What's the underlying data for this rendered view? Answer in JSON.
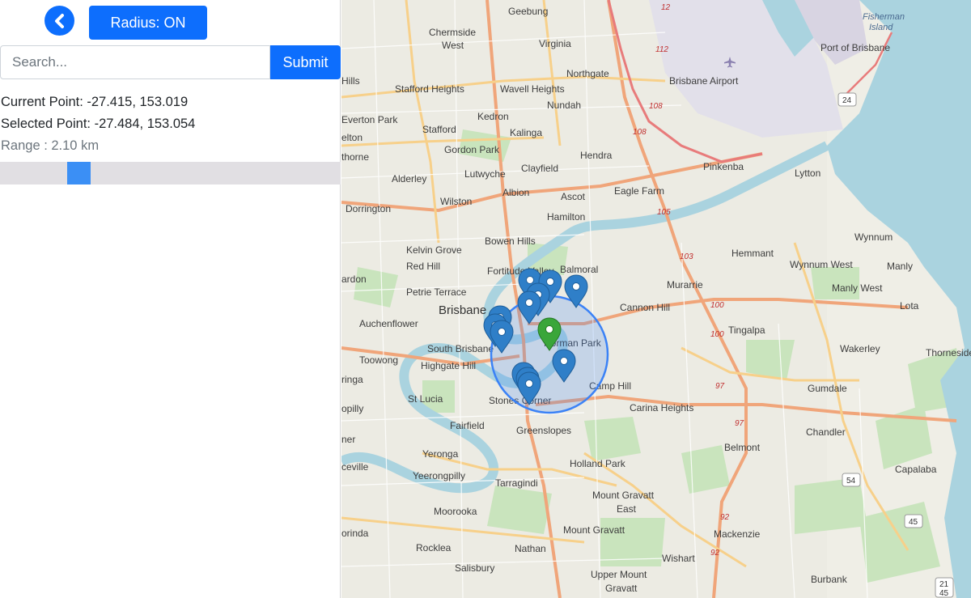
{
  "toolbar": {
    "back_icon": "chevron-left-icon",
    "radius_label": "Radius: ON"
  },
  "search": {
    "placeholder": "Search...",
    "value": "",
    "submit_label": "Submit"
  },
  "info": {
    "current_point": "Current Point: -27.415, 153.019",
    "selected_point": "Selected Point: -27.484, 153.054",
    "range": "Range : 2.10 km"
  },
  "range_slider": {
    "value_fraction": 0.23
  },
  "map": {
    "suburbs": [
      "Geebung",
      "Chermside",
      "West",
      "Virginia",
      "Northgate",
      "Stafford Heights",
      "Wavell Heights",
      "Nundah",
      "Brisbane Airport",
      "Port of Brisbane",
      "Fisherman",
      "Island",
      "Everton Park",
      "Kedron",
      "Stafford",
      "Kalinga",
      "Gordon Park",
      "Hendra",
      "Pinkenba",
      "Lytton",
      "Alderley",
      "Lutwyche",
      "Clayfield",
      "Ascot",
      "Eagle Farm",
      "Wilston",
      "Albion",
      "Hamilton",
      "Dorrington",
      "Bowen Hills",
      "Kelvin Grove",
      "Red Hill",
      "Fortitude Valley",
      "Balmoral",
      "Hemmant",
      "Wynnum",
      "Wynnum West",
      "Manly",
      "Petrie Terrace",
      "Brisbane",
      "Murarrie",
      "Cannon Hill",
      "Manly West",
      "Lota",
      "Auchenflower",
      "Norman Park",
      "Tingalpa",
      "South Brisbane",
      "Toowong",
      "Highgate Hill",
      "Wakerley",
      "Thorneside",
      "Camp Hill",
      "Gumdale",
      "St Lucia",
      "Stones Corner",
      "Carina Heights",
      "Fairfield",
      "Greenslopes",
      "Chandler",
      "Belmont",
      "Yeronga",
      "Holland Park",
      "Capalaba",
      "Yeerongpilly",
      "Tarragindi",
      "Moorooka",
      "Mount Gravatt",
      "East",
      "Mackenzie",
      "Rocklea",
      "Nathan",
      "Wishart",
      "Salisbury",
      "Upper Mount",
      "Gravatt",
      "Burbank",
      "Hills",
      "elton",
      "thorne",
      "ardon",
      "ringa",
      "opilly",
      "ner",
      "ceville",
      "orinda"
    ],
    "road_numbers": [
      "112",
      "12",
      "24",
      "108",
      "108",
      "105",
      "103",
      "100",
      "100",
      "97",
      "97",
      "92",
      "92"
    ],
    "shields": [
      "24",
      "54",
      "45",
      "21",
      "45"
    ],
    "marker_color": "#2f7fc8",
    "selected_marker_color": "#3aa63a",
    "radius_circle_color": "#3b82f6"
  }
}
